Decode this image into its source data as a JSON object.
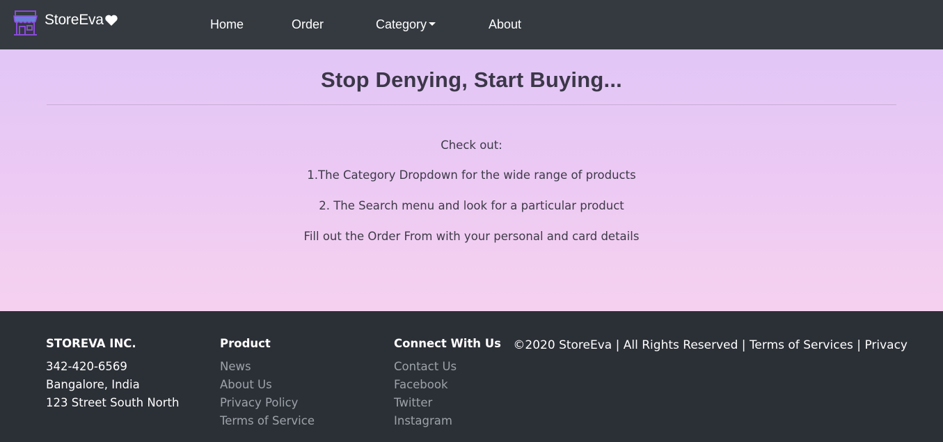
{
  "navbar": {
    "brand_name": "StoreEva",
    "brand_icon": "storefront-icon",
    "heart_icon": "heart-icon",
    "links": {
      "home": "Home",
      "order": "Order",
      "category": "Category",
      "about": "About"
    }
  },
  "hero": {
    "title": "Stop Denying, Start Buying...",
    "lines": [
      "Check out:",
      "1.The Category Dropdown for the wide range of products",
      "2. The Search menu and look for a particular product",
      "Fill out the Order From with your personal and card details"
    ]
  },
  "footer": {
    "company": {
      "heading": "STOREVA INC.",
      "phone": "342-420-6569",
      "city": "Bangalore, India",
      "street": "123 Street South North"
    },
    "product": {
      "heading": "Product",
      "items": [
        "News",
        "About Us",
        "Privacy Policy",
        "Terms of Service"
      ]
    },
    "connect": {
      "heading": "Connect With Us",
      "items": [
        "Contact Us",
        "Facebook",
        "Twitter",
        "Instagram"
      ]
    },
    "copyright": {
      "text": "©2020 StoreEva | All Rights Reserved |",
      "terms": "Terms of Services",
      "separator": "|",
      "privacy": "Privacy"
    }
  },
  "colors": {
    "navbar_bg": "#343a40",
    "footer_bg": "#2b2f36",
    "hero_gradient_top": "#e1c6f6",
    "hero_gradient_bottom": "#f6d1ef",
    "logo_accent": "#8a4bd8"
  }
}
